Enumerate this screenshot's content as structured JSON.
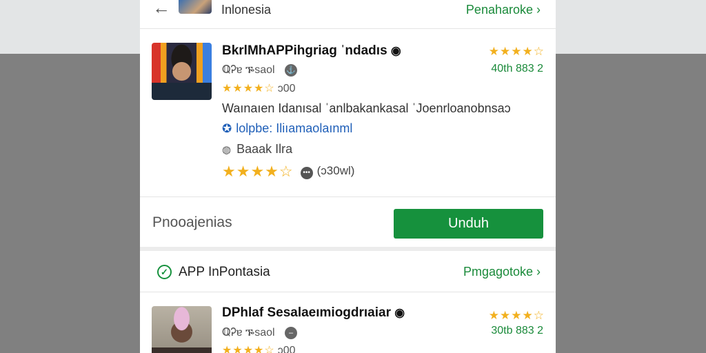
{
  "header": {
    "back_icon": "arrow-left-icon",
    "title": "Inlonesia",
    "link": "Penaharoke ›"
  },
  "app1": {
    "title": "BkrlMhAPPihgriag ˈndadıs",
    "badge_icon": "verified-icon",
    "badge_glyph": "◉",
    "subtitle": "ℚᎮɐ ᎏsaol",
    "sub_icon_glyph": "⚓",
    "stars_small": "★★★★☆",
    "stars_small_count": "ɔ00",
    "description": "Waınaıen Idanısal ˈanlbakankasal ˈJoenrloanobnsaɔ",
    "developer_icon_glyph": "✪",
    "developer": "lolpbe: Iliıamaolaınml",
    "location_icon_glyph": "◍",
    "location": "Baaak Ilra",
    "stars_large": "★★★★☆",
    "bubble_glyph": "•••",
    "review_count": "(ɔ30wl)",
    "right_stars": "★★★★☆",
    "right_count": "40th 883 2"
  },
  "action": {
    "label": "Pnooajenias",
    "button": "Unduh"
  },
  "section": {
    "check_glyph": "✓",
    "title": "APP InPontasia",
    "link": "Pmgagotoke ›"
  },
  "app2": {
    "title": "DPhlaf Sesalaeımiogdrıaiar",
    "badge_glyph": "◉",
    "subtitle": "ℚᎮɐ ᎏsaol",
    "sub_icon_glyph": "–",
    "stars_small": "★★★★☆",
    "stars_small_count": "ɔ00",
    "right_stars": "★★★★☆",
    "right_count": "30tb 883 2"
  },
  "colors": {
    "accent_green": "#16913d",
    "link_green": "#1a8a3a",
    "star_yellow": "#f2b01e",
    "link_blue": "#1f5fb8"
  }
}
